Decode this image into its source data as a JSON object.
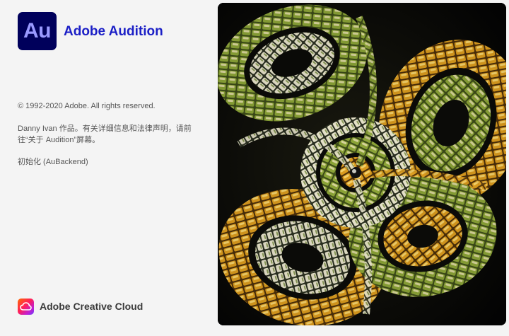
{
  "app": {
    "logo_text": "Au",
    "title": "Adobe Audition"
  },
  "info": {
    "copyright": "© 1992-2020 Adobe. All rights reserved.",
    "credits": "Danny Ivan 作品。有关详细信息和法律声明，请前往“关于 Audition”屏幕。",
    "status": "初始化 (AuBackend)"
  },
  "footer": {
    "label": "Adobe Creative Cloud",
    "icon": "creative-cloud-icon"
  },
  "colors": {
    "logo_bg": "#00005b",
    "logo_text": "#9999ff",
    "title": "#1b1fc6",
    "panel_bg": "#f4f4f4"
  }
}
